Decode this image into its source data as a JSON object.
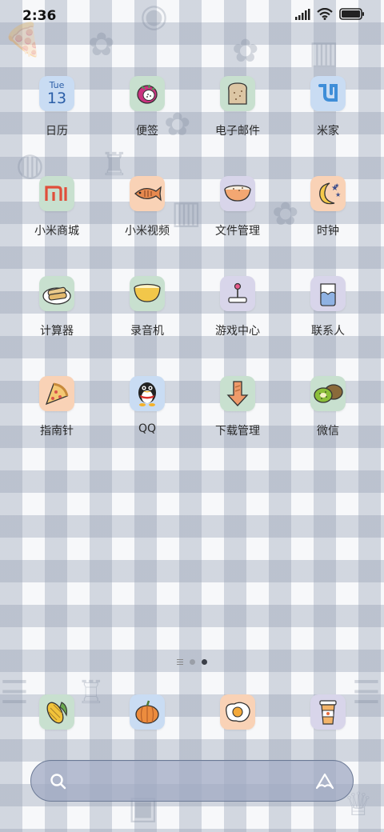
{
  "status": {
    "time": "2:36"
  },
  "apps": [
    {
      "name": "calendar",
      "label": "日历",
      "bg": "#c9dcf3",
      "day": "Tue",
      "date": "13"
    },
    {
      "name": "notes",
      "label": "便签",
      "bg": "#c8e0cf"
    },
    {
      "name": "email",
      "label": "电子邮件",
      "bg": "#c8e0cf"
    },
    {
      "name": "mijia",
      "label": "米家",
      "bg": "#c9dcf3"
    },
    {
      "name": "mi-store",
      "label": "小米商城",
      "bg": "#c8e0cf"
    },
    {
      "name": "mi-video",
      "label": "小米视频",
      "bg": "#f9d2b6"
    },
    {
      "name": "file-manager",
      "label": "文件管理",
      "bg": "#d8d5ea"
    },
    {
      "name": "clock",
      "label": "时钟",
      "bg": "#f9d2b6"
    },
    {
      "name": "calculator",
      "label": "计算器",
      "bg": "#c8e0cf"
    },
    {
      "name": "recorder",
      "label": "录音机",
      "bg": "#c8e0cf"
    },
    {
      "name": "game-center",
      "label": "游戏中心",
      "bg": "#d8d5ea"
    },
    {
      "name": "contacts",
      "label": "联系人",
      "bg": "#d8d5ea"
    },
    {
      "name": "compass",
      "label": "指南针",
      "bg": "#f9d2b6"
    },
    {
      "name": "qq",
      "label": "QQ",
      "bg": "#c9dcf3"
    },
    {
      "name": "download-manager",
      "label": "下载管理",
      "bg": "#c8e0cf"
    },
    {
      "name": "wechat",
      "label": "微信",
      "bg": "#c8e0cf"
    }
  ],
  "dock": [
    {
      "name": "phone",
      "bg": "#c8e0cf"
    },
    {
      "name": "messages",
      "bg": "#c9dcf3"
    },
    {
      "name": "browser",
      "bg": "#f9d2b6"
    },
    {
      "name": "camera",
      "bg": "#d8d5ea"
    }
  ]
}
